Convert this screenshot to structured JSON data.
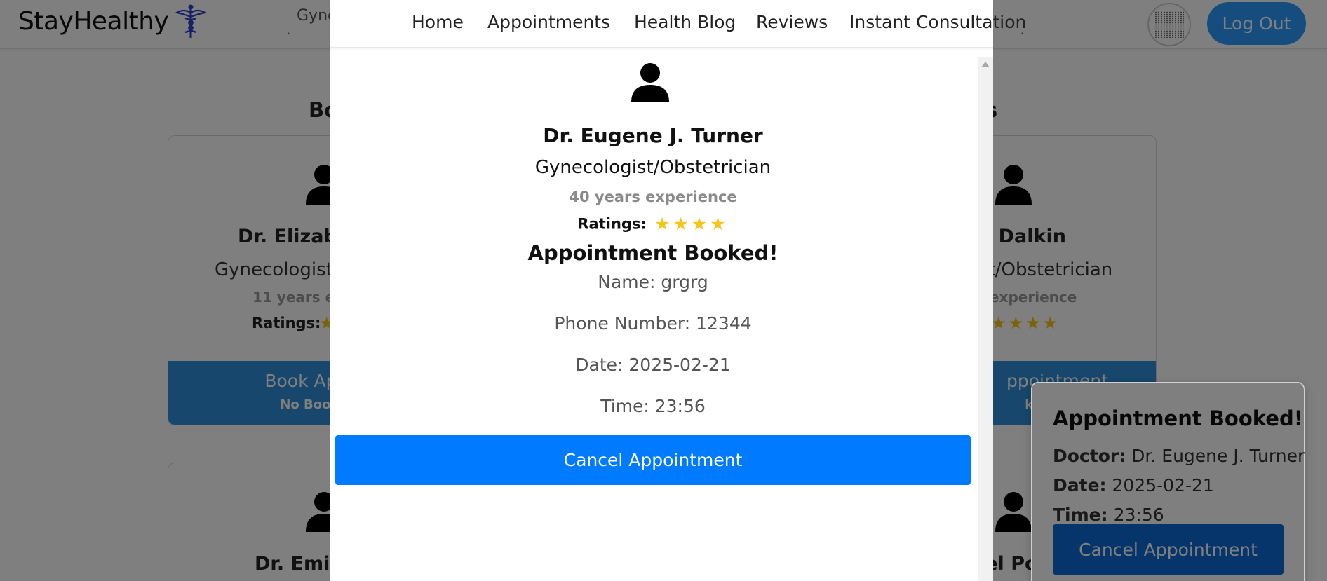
{
  "app": {
    "logo_text": "StayHealthy",
    "logout_label": "Log Out",
    "search_value": "Gyne"
  },
  "background": {
    "heading_left": "Bo",
    "heading_right": "ils",
    "cards": [
      {
        "name": "Dr. Elizabe",
        "speciality": "Gynecologist/",
        "experience": "11 years ex",
        "ratings_label": "Ratings:",
        "stars": "★",
        "book_label": "Book Appo",
        "no_booking": "No Booki"
      },
      {
        "name": "n Dalkin",
        "speciality": "st/Obstetrician",
        "experience": "experience",
        "stars": "★★★★",
        "book_label": "ppointment",
        "no_booking": "king F"
      },
      {
        "name": "Dr. Emily"
      },
      {
        "name": "hel Po"
      }
    ]
  },
  "modal": {
    "nav": {
      "home": "Home",
      "appointments": "Appointments",
      "health_blog": "Health Blog",
      "reviews": "Reviews",
      "instant_consultation": "Instant Consultation"
    },
    "doctor_name": "Dr. Eugene J. Turner",
    "speciality": "Gynecologist/Obstetrician",
    "experience": "40 years experience",
    "ratings_label": "Ratings:",
    "stars": "★★★★",
    "star_count": 4,
    "booked_title": "Appointment Booked!",
    "name_line": "Name: grgrg",
    "phone_line": "Phone Number: 12344",
    "date_line": "Date: 2025-02-21",
    "time_line": "Time: 23:56",
    "cancel_label": "Cancel Appointment"
  },
  "side_toast": {
    "title": "Appointment Booked!",
    "doctor_label": "Doctor:",
    "doctor_value": "Dr. Eugene J. Turner",
    "date_label": "Date:",
    "date_value": "2025-02-21",
    "time_label": "Time:",
    "time_value": "23:56",
    "cancel_label": "Cancel Appointment"
  },
  "colors": {
    "primary_button": "#007bff",
    "logout_button": "#2d9bff",
    "star": "#f5c518",
    "book_button": "#2e8fd8",
    "caduceus": "#2f3fd0"
  }
}
